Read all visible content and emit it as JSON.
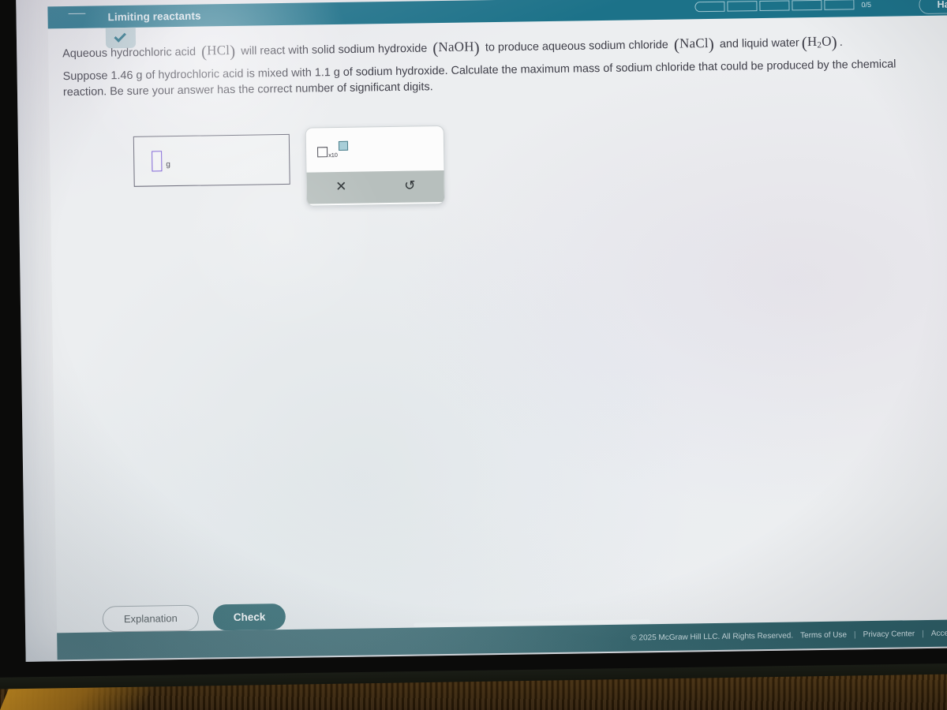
{
  "header": {
    "menu_icon": "hamburger-menu-icon",
    "title": "Limiting reactants",
    "progress": {
      "segments": 5,
      "count_label": "0/5"
    },
    "user_name": "Hannah"
  },
  "panel_toggle": {
    "icon": "chevron-down-icon"
  },
  "problem": {
    "line1_a": "Aqueous hydrochloric acid",
    "formula_hcl": "HCl",
    "line1_b": "will react with solid sodium hydroxide",
    "formula_naoh": "NaOH",
    "line1_c": "to produce aqueous sodium chloride",
    "formula_nacl": "NaCl",
    "line1_d": "and liquid water",
    "formula_h2o_pre": "H",
    "formula_h2o_sub": "2",
    "formula_h2o_post": "O",
    "line1_end": ".",
    "line2": "Suppose 1.46 g of hydrochloric acid is mixed with 1.1 g of sodium hydroxide. Calculate the maximum mass of sodium chloride that could be produced by the chemical reaction. Be sure your answer has the correct number of significant digits."
  },
  "answer": {
    "value": "",
    "unit": "g",
    "slot_color": "#7b5fd6"
  },
  "math_toolbar": {
    "scientific_notation": {
      "icon": "scientific-notation-icon",
      "mantissa_box": "",
      "multiplier_label": "x10",
      "exponent_box": ""
    },
    "clear_label": "✕",
    "undo_label": "↺",
    "clear_icon": "clear-icon",
    "undo_icon": "undo-icon"
  },
  "side_tools": [
    {
      "icon": "periodic-table-icon",
      "glyph": ""
    },
    {
      "icon": "calculator-icon",
      "glyph": ""
    },
    {
      "icon": "notes-icon",
      "glyph": "▲"
    }
  ],
  "actions": {
    "explanation_label": "Explanation",
    "check_label": "Check"
  },
  "footer": {
    "copyright": "© 2025 McGraw Hill LLC. All Rights Reserved.",
    "links": [
      "Terms of Use",
      "Privacy Center",
      "Accessibility"
    ],
    "separator": "|"
  },
  "colors": {
    "header_teal": "#1c7289",
    "footer_teal": "#2d5f67",
    "check_button": "#1d5b63",
    "chevron_teal": "#16697f",
    "exponent_highlight": "#a8ced8"
  }
}
